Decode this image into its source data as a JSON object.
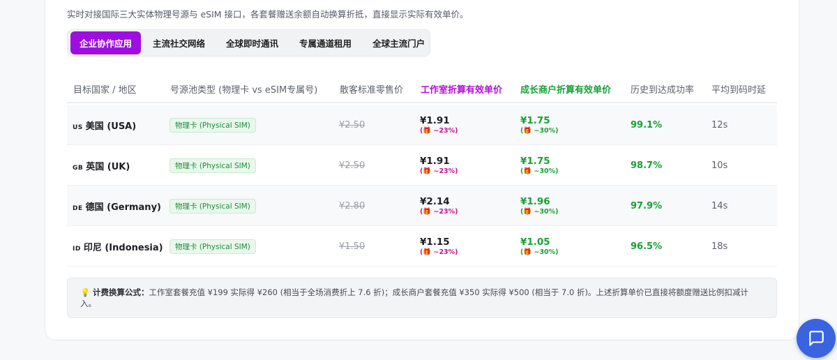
{
  "description": "实时对接国际三大实体物理号源与 eSIM 接口，各套餐赠送余额自动换算折抵，直接显示实际有效单价。",
  "tabs": [
    {
      "label": "企业协作应用",
      "active": true
    },
    {
      "label": "主流社交网络",
      "active": false
    },
    {
      "label": "全球即时通讯",
      "active": false
    },
    {
      "label": "专属通道租用",
      "active": false
    },
    {
      "label": "全球主流门户",
      "active": false
    }
  ],
  "table": {
    "headers": {
      "country": "目标国家 / 地区",
      "pool": "号源池类型 (物理卡 vs eSIM专属号)",
      "retail": "散客标准零售价",
      "studio": "工作室折算有效单价",
      "merchant": "成长商户折算有效单价",
      "rate": "历史到达成功率",
      "latency": "平均到码时延"
    },
    "rows": [
      {
        "code": "US",
        "country": "美国 (USA)",
        "pool": "物理卡 (Physical SIM)",
        "retail": "¥2.50",
        "studio_price": "¥1.91",
        "studio_disc": "(🎁 ~23%)",
        "merchant_price": "¥1.75",
        "merchant_disc": "(🎁 ~30%)",
        "rate": "99.1%",
        "latency": "12s"
      },
      {
        "code": "GB",
        "country": "英国 (UK)",
        "pool": "物理卡 (Physical SIM)",
        "retail": "¥2.50",
        "studio_price": "¥1.91",
        "studio_disc": "(🎁 ~23%)",
        "merchant_price": "¥1.75",
        "merchant_disc": "(🎁 ~30%)",
        "rate": "98.7%",
        "latency": "10s"
      },
      {
        "code": "DE",
        "country": "德国 (Germany)",
        "pool": "物理卡 (Physical SIM)",
        "retail": "¥2.80",
        "studio_price": "¥2.14",
        "studio_disc": "(🎁 ~23%)",
        "merchant_price": "¥1.96",
        "merchant_disc": "(🎁 ~30%)",
        "rate": "97.9%",
        "latency": "14s"
      },
      {
        "code": "ID",
        "country": "印尼 (Indonesia)",
        "pool": "物理卡 (Physical SIM)",
        "retail": "¥1.50",
        "studio_price": "¥1.15",
        "studio_disc": "(🎁 ~23%)",
        "merchant_price": "¥1.05",
        "merchant_disc": "(🎁 ~30%)",
        "rate": "96.5%",
        "latency": "18s"
      }
    ]
  },
  "formula": {
    "icon": "lightbulb-icon",
    "label": "计费换算公式：",
    "text": "工作室套餐充值 ¥199 实际得 ¥260 (相当于全场消费折上 7.6 折)；成长商户套餐充值 ¥350 实际得 ¥500 (相当于 7.0 折)。上述折算单价已直接将额度赠送比例扣减计入。"
  },
  "chat_button": {
    "icon": "chat-icon"
  },
  "colors": {
    "accent": "#9e0ee0",
    "studio": "#b40fd6",
    "merchant": "#18a136",
    "chat": "#3a63e0"
  }
}
